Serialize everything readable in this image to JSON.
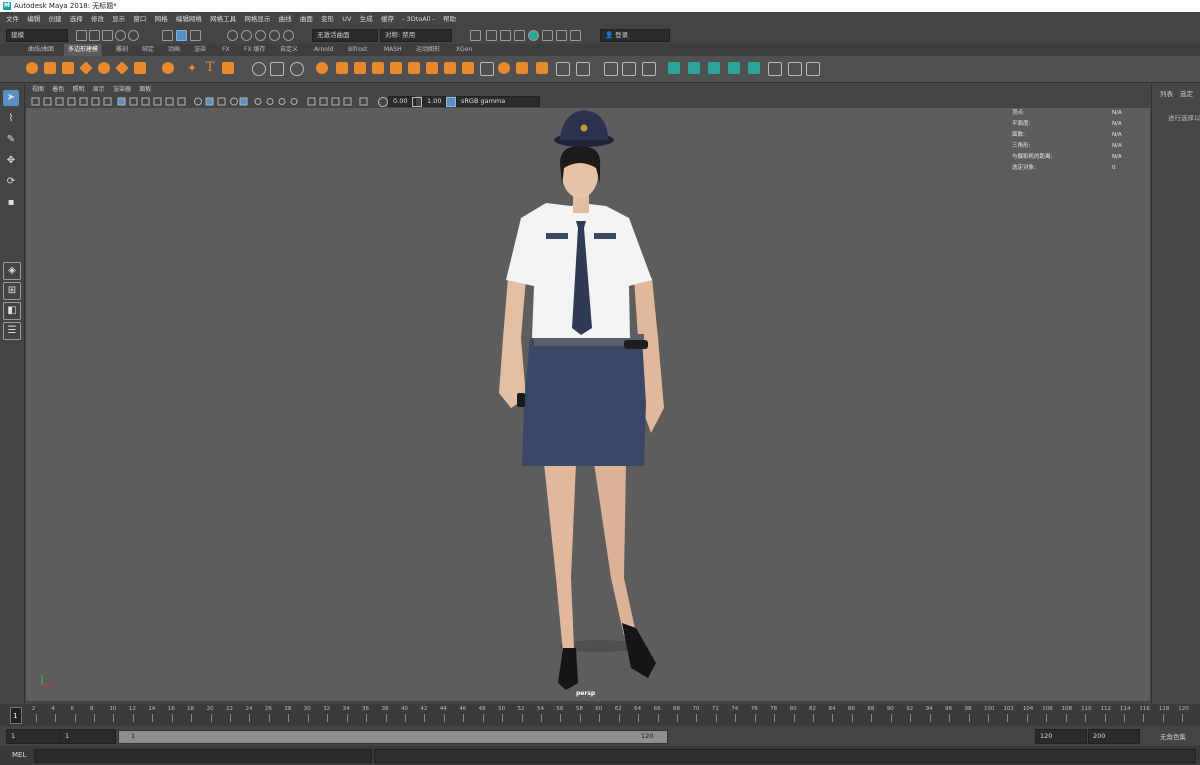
{
  "window": {
    "title": "Autodesk Maya 2018: 无标题*"
  },
  "menus": [
    "文件",
    "编辑",
    "创建",
    "选择",
    "修改",
    "显示",
    "窗口",
    "网格",
    "编辑网格",
    "网格工具",
    "网格显示",
    "曲线",
    "曲面",
    "变形",
    "UV",
    "生成",
    "缓存",
    "- 3DtoAll -",
    "帮助"
  ],
  "status_line": {
    "mode": "建模",
    "live_surface": "无激活曲面",
    "symmetry": "对称: 禁用",
    "login": "登录"
  },
  "shelf_tabs": [
    "曲线/曲面",
    "多边形建模",
    "雕刻",
    "绑定",
    "动画",
    "渲染",
    "FX",
    "FX 缓存",
    "自定义",
    "Arnold",
    "Bifrost",
    "MASH",
    "运动图形",
    "XGen"
  ],
  "shelf_active_tab": "多边形建模",
  "viewport_menu": [
    "视图",
    "着色",
    "照明",
    "显示",
    "渲染器",
    "面板"
  ],
  "viewport_toolbar": {
    "exposure": "0.00",
    "gamma": "1.00",
    "color_space": "sRGB gamma"
  },
  "hud": [
    {
      "label": "顶点:",
      "value": "N/A"
    },
    {
      "label": "平面度:",
      "value": "N/A"
    },
    {
      "label": "面数:",
      "value": "N/A"
    },
    {
      "label": "三角形:",
      "value": "N/A"
    },
    {
      "label": "与摄影机的距离:",
      "value": "N/A"
    },
    {
      "label": "选定对象:",
      "value": "0"
    }
  ],
  "camera_label": "persp",
  "right_panel": {
    "tabs": [
      "列表",
      "选定"
    ],
    "hint": "进行选择以"
  },
  "timeline": {
    "ticks": [
      "2",
      "4",
      "6",
      "8",
      "10",
      "12",
      "14",
      "16",
      "18",
      "20",
      "22",
      "24",
      "26",
      "28",
      "30",
      "32",
      "34",
      "36",
      "38",
      "40",
      "42",
      "44",
      "46",
      "48",
      "50",
      "52",
      "54",
      "56",
      "58",
      "60",
      "62",
      "64",
      "66",
      "68",
      "70",
      "72",
      "74",
      "76",
      "78",
      "80",
      "82",
      "84",
      "86",
      "88",
      "90",
      "92",
      "94",
      "96",
      "98",
      "100",
      "102",
      "104",
      "106",
      "108",
      "110",
      "112",
      "114",
      "116",
      "118",
      "120"
    ],
    "current_frame": "1"
  },
  "range": {
    "start": "1",
    "playback_start": "1",
    "slider_start": "1",
    "slider_end": "120",
    "playback_end": "120",
    "end": "200",
    "character_set": "无角色集"
  },
  "command_line": {
    "label": "MEL"
  },
  "colors": {
    "accent": "#5a8fc3",
    "shelf_orange": "#e8892d",
    "shelf_teal": "#2fa59a",
    "viewport_bg": "#5d5d5d"
  }
}
